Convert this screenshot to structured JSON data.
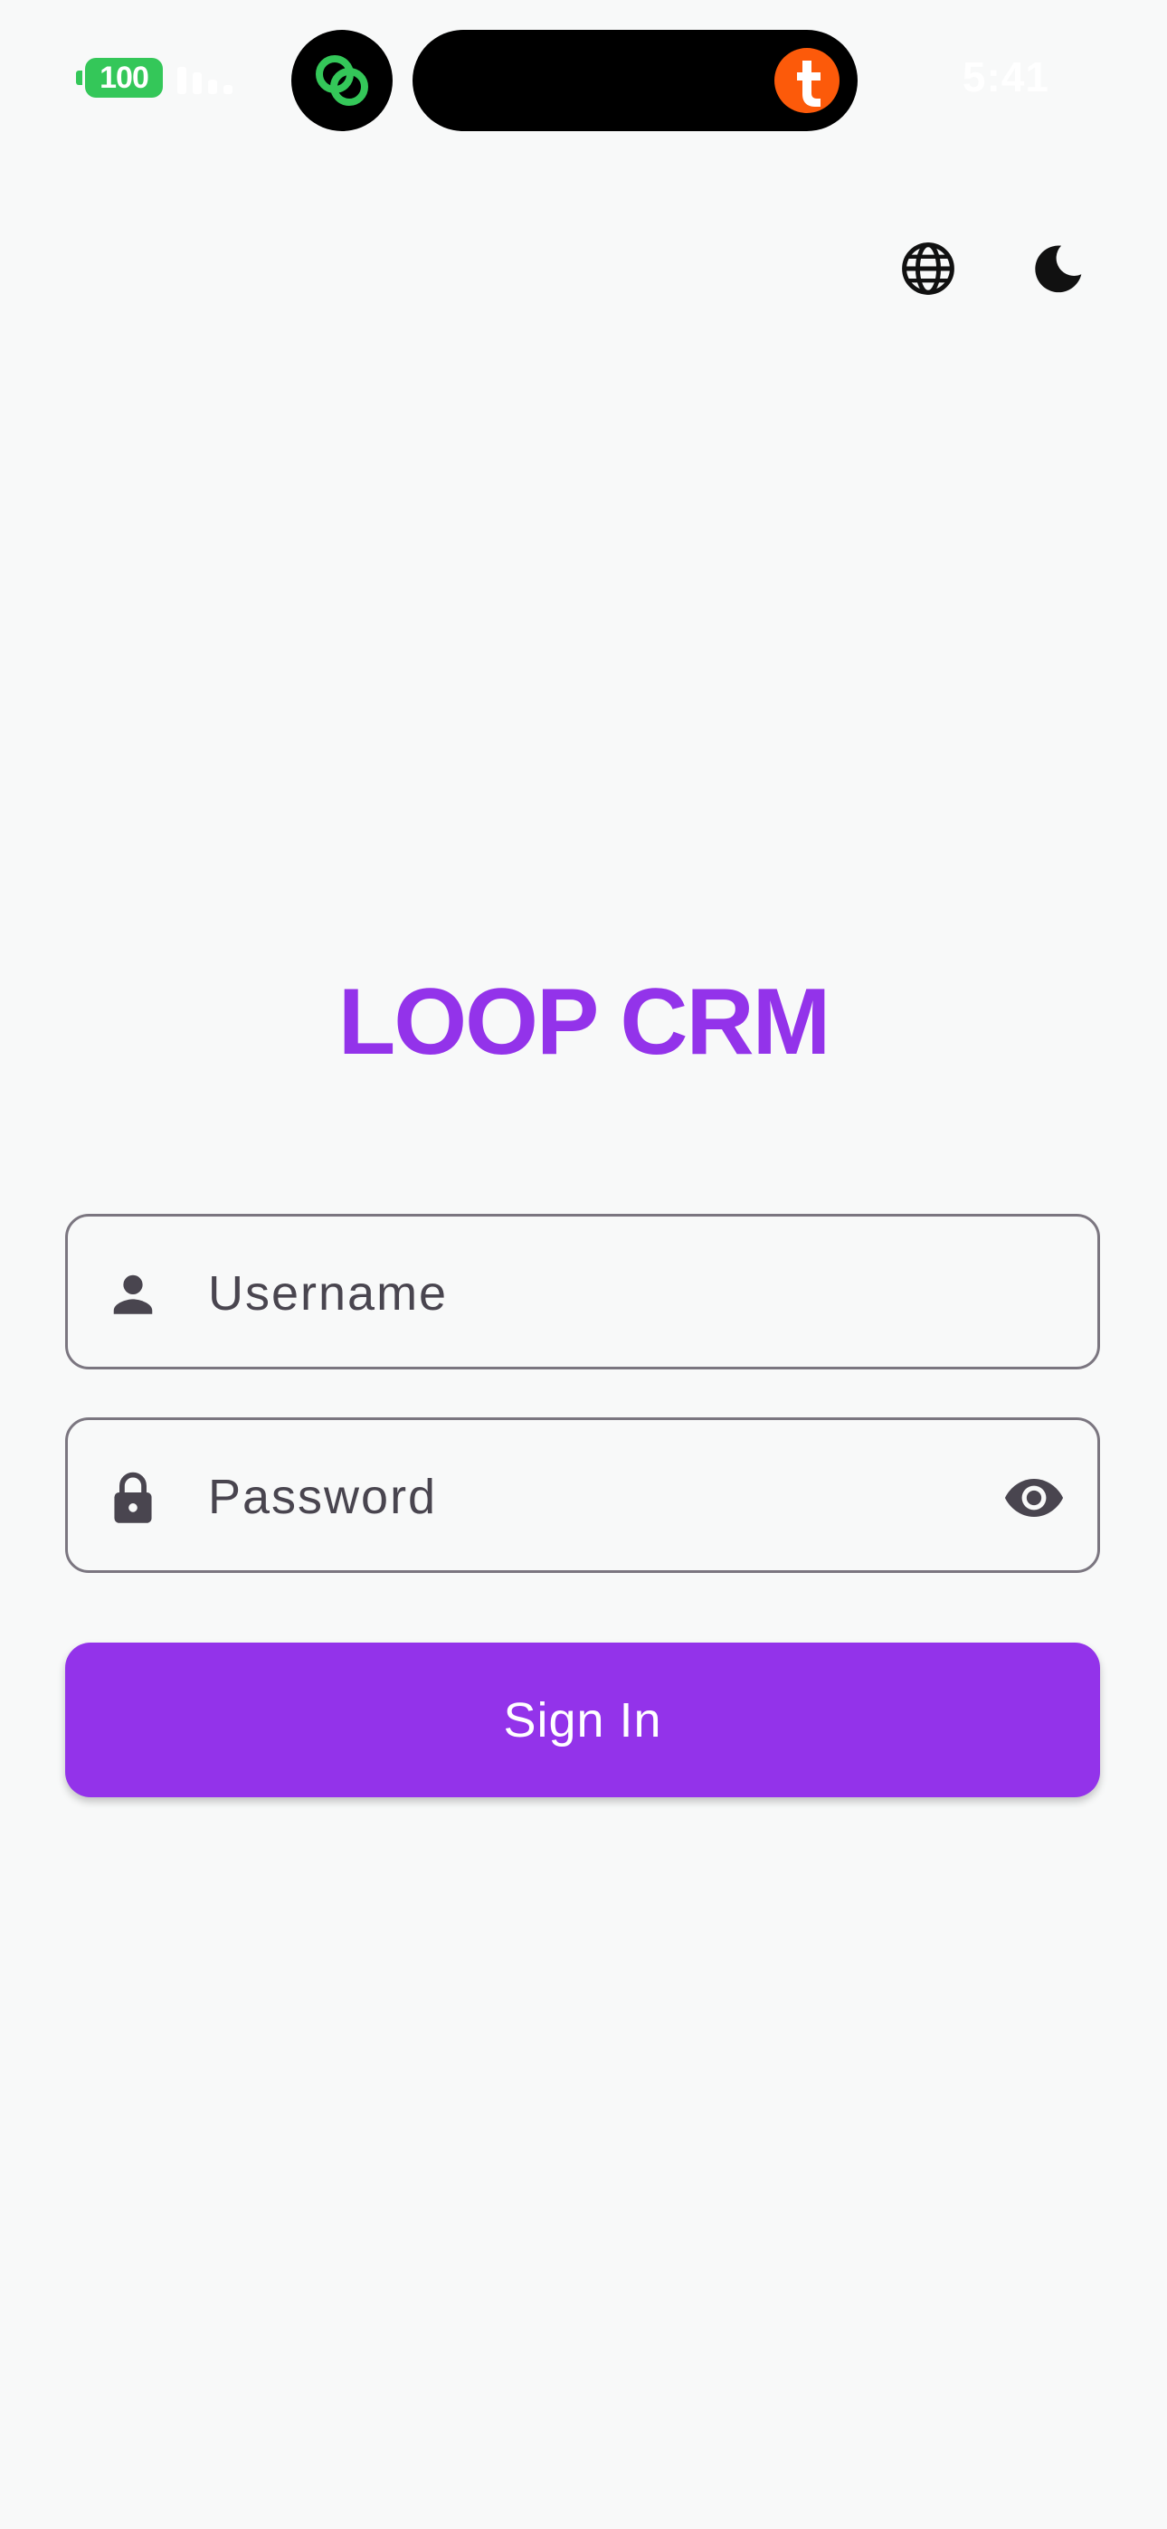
{
  "status_bar": {
    "battery_level": "100",
    "time": "5:41",
    "colors": {
      "battery": "#34c759",
      "notification_app_icon": "#fc5a0a",
      "link_app_icon": "#34c759"
    }
  },
  "top_actions": {
    "language_icon": "globe-icon",
    "theme_icon": "moon-icon"
  },
  "app": {
    "title": "LOOP CRM",
    "accent_color": "#9333ea"
  },
  "login_form": {
    "username": {
      "placeholder": "Username",
      "value": "",
      "icon": "person-icon"
    },
    "password": {
      "placeholder": "Password",
      "value": "",
      "icon": "lock-icon",
      "toggle_icon": "eye-icon"
    },
    "submit_label": "Sign In"
  }
}
